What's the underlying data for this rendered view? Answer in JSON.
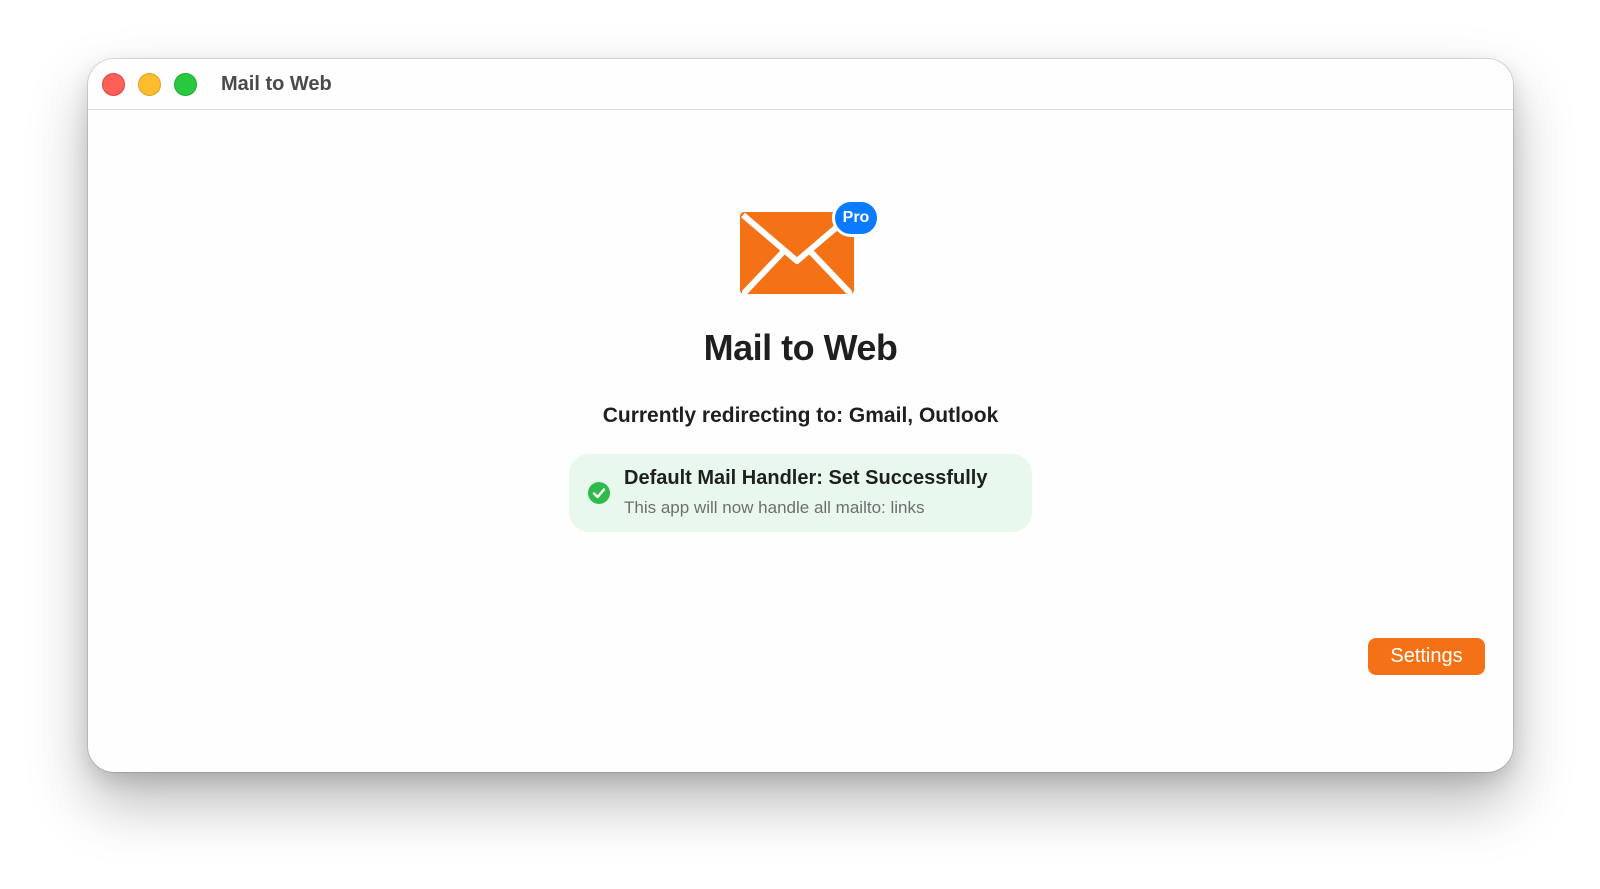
{
  "window": {
    "title": "Mail to Web"
  },
  "app": {
    "name": "Mail to Web",
    "badge": "Pro",
    "icon": "envelope-icon",
    "accent_color": "#f57115",
    "badge_color": "#0a7aff"
  },
  "redirect": {
    "label": "Currently redirecting to: ",
    "targets": "Gmail, Outlook"
  },
  "status": {
    "icon": "checkmark-circle-icon",
    "color": "#2fbb4c",
    "title": "Default Mail Handler: Set Successfully",
    "subtitle": "This app will now handle all mailto: links"
  },
  "footer": {
    "settings_label": "Settings"
  }
}
